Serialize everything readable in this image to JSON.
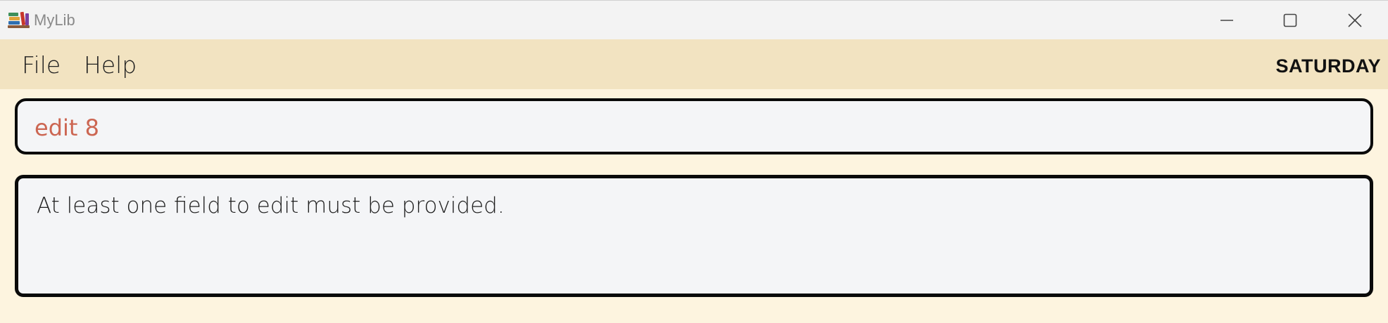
{
  "window": {
    "title": "MyLib",
    "icon": "books-icon",
    "controls": [
      "minimize-icon",
      "maximize-icon",
      "close-icon"
    ]
  },
  "menubar": {
    "items": [
      {
        "label": "File"
      },
      {
        "label": "Help"
      }
    ],
    "day": "SATURDAY"
  },
  "command": {
    "value": "edit 8"
  },
  "result": {
    "message": "At least one field to edit must be provided."
  },
  "colors": {
    "background": "#fdf4df",
    "menubar": "#f2e3c1",
    "command_text": "#cc6652",
    "box_border": "#0a0a0a",
    "box_fill": "#f4f5f7"
  }
}
